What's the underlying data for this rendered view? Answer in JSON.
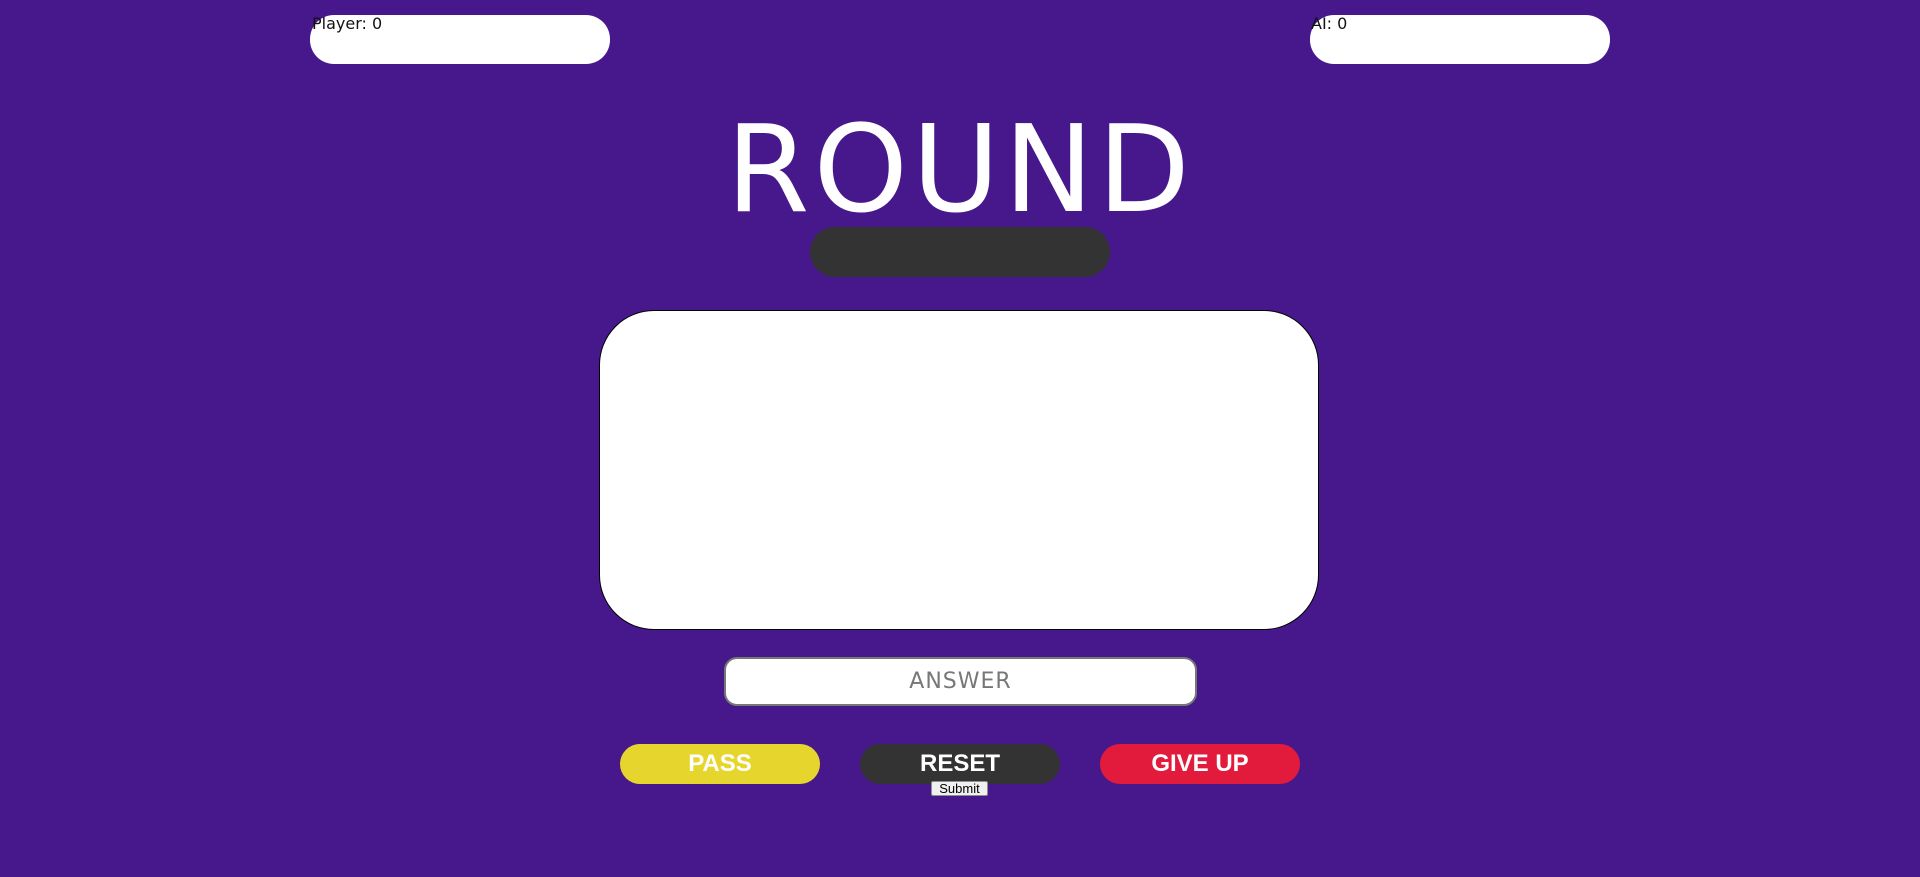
{
  "scoreboard": {
    "player_text": "Player: 0",
    "ai_text": "AI: 0"
  },
  "round": {
    "title": "ROUND",
    "indicator_text": ""
  },
  "question": {
    "text": ""
  },
  "answer": {
    "placeholder": "ANSWER",
    "value": ""
  },
  "actions": {
    "pass_label": "PASS",
    "reset_label": "RESET",
    "giveup_label": "GIVE UP",
    "submit_label": "Submit"
  },
  "colors": {
    "background": "#47188c",
    "pass": "#e6d52c",
    "reset": "#333333",
    "give_up": "#e21b3c",
    "panel": "#ffffff"
  }
}
